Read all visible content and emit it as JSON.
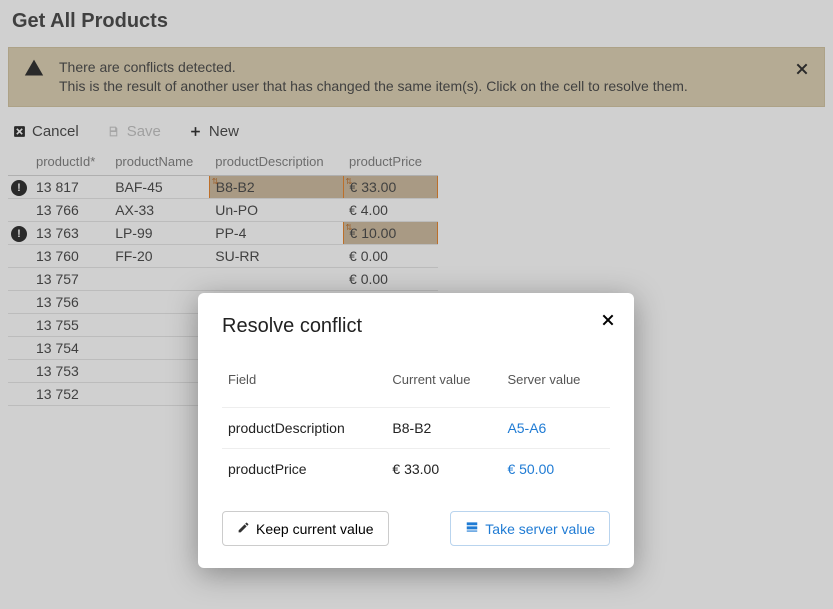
{
  "header": {
    "title": "Get All Products"
  },
  "alert": {
    "line1": "There are conflicts detected.",
    "line2": "This is the result of another user that has changed the same item(s). Click on the cell to resolve them."
  },
  "toolbar": {
    "cancel": "Cancel",
    "save": "Save",
    "new_": "New"
  },
  "table": {
    "columns": [
      "productId*",
      "productName",
      "productDescription",
      "productPrice"
    ],
    "rows": [
      {
        "flag": true,
        "id": "13 817",
        "name": "BAF-45",
        "desc": "B8-B2",
        "price": "€ 33.00",
        "conflict_desc": true,
        "conflict_price": true
      },
      {
        "flag": false,
        "id": "13 766",
        "name": "AX-33",
        "desc": "Un-PO",
        "price": "€ 4.00",
        "conflict_desc": false,
        "conflict_price": false
      },
      {
        "flag": true,
        "id": "13 763",
        "name": "LP-99",
        "desc": "PP-4",
        "price": "€ 10.00",
        "conflict_desc": false,
        "conflict_price": true
      },
      {
        "flag": false,
        "id": "13 760",
        "name": "FF-20",
        "desc": "SU-RR",
        "price": "€ 0.00",
        "conflict_desc": false,
        "conflict_price": false
      },
      {
        "flag": false,
        "id": "13 757",
        "name": "",
        "desc": "",
        "price": "€ 0.00",
        "conflict_desc": false,
        "conflict_price": false
      },
      {
        "flag": false,
        "id": "13 756",
        "name": "",
        "desc": "",
        "price": "",
        "conflict_desc": false,
        "conflict_price": false
      },
      {
        "flag": false,
        "id": "13 755",
        "name": "",
        "desc": "",
        "price": "",
        "conflict_desc": false,
        "conflict_price": false
      },
      {
        "flag": false,
        "id": "13 754",
        "name": "",
        "desc": "",
        "price": "",
        "conflict_desc": false,
        "conflict_price": false
      },
      {
        "flag": false,
        "id": "13 753",
        "name": "",
        "desc": "",
        "price": "",
        "conflict_desc": false,
        "conflict_price": false
      },
      {
        "flag": false,
        "id": "13 752",
        "name": "",
        "desc": "",
        "price": "",
        "conflict_desc": false,
        "conflict_price": false
      }
    ]
  },
  "dialog": {
    "title": "Resolve conflict",
    "columns": [
      "Field",
      "Current value",
      "Server value"
    ],
    "rows": [
      {
        "field": "productDescription",
        "current": "B8-B2",
        "server": "A5-A6"
      },
      {
        "field": "productPrice",
        "current": "€ 33.00",
        "server": "€ 50.00"
      }
    ],
    "keep_label": "Keep current value",
    "take_label": "Take server value"
  }
}
